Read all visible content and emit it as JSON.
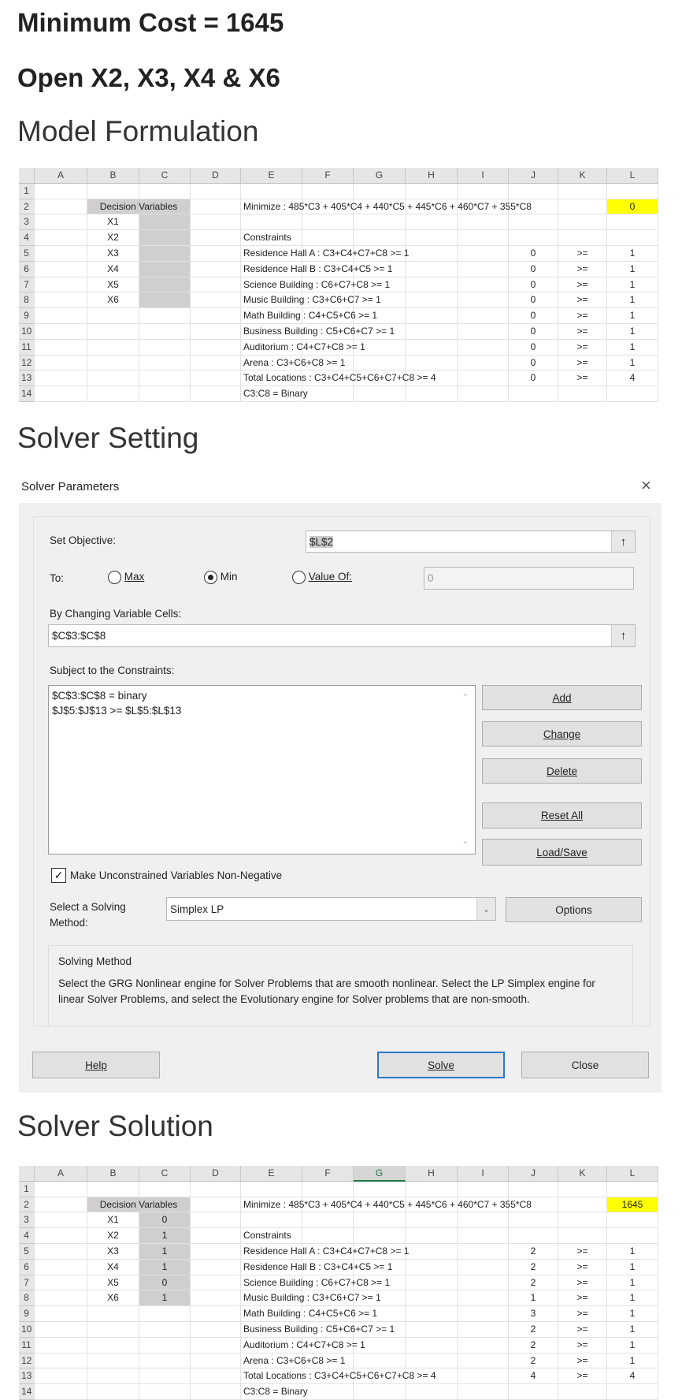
{
  "headings": {
    "min_cost": "Minimum Cost = 1645",
    "open": "Open X2, X3, X4 & X6",
    "model": "Model Formulation",
    "setting": "Solver Setting",
    "solution": "Solver Solution"
  },
  "columns": [
    "A",
    "B",
    "C",
    "D",
    "E",
    "F",
    "G",
    "H",
    "I",
    "J",
    "K",
    "L"
  ],
  "row_numbers": [
    "1",
    "2",
    "3",
    "4",
    "5",
    "6",
    "7",
    "8",
    "9",
    "10",
    "11",
    "12",
    "13",
    "14"
  ],
  "model_sheet": {
    "decision_header": "Decision Variables",
    "variables": [
      "X1",
      "X2",
      "X3",
      "X4",
      "X5",
      "X6"
    ],
    "values": [
      "",
      "",
      "",
      "",
      "",
      ""
    ],
    "objective_label": "Minimize : 485*C3 + 405*C4 + 440*C5 + 445*C6 + 460*C7 + 355*C8",
    "objective_value": "0",
    "constraints_header": "Constraints",
    "constraints": [
      {
        "label": "Residence Hall A : C3+C4+C7+C8 >= 1",
        "lhs": "0",
        "op": ">=",
        "rhs": "1"
      },
      {
        "label": "Residence Hall B : C3+C4+C5 >= 1",
        "lhs": "0",
        "op": ">=",
        "rhs": "1"
      },
      {
        "label": "Science Building : C6+C7+C8 >= 1",
        "lhs": "0",
        "op": ">=",
        "rhs": "1"
      },
      {
        "label": "Music Building : C3+C6+C7 >= 1",
        "lhs": "0",
        "op": ">=",
        "rhs": "1"
      },
      {
        "label": "Math Building : C4+C5+C6 >= 1",
        "lhs": "0",
        "op": ">=",
        "rhs": "1"
      },
      {
        "label": "Business Building : C5+C6+C7 >= 1",
        "lhs": "0",
        "op": ">=",
        "rhs": "1"
      },
      {
        "label": "Auditorium : C4+C7+C8 >= 1",
        "lhs": "0",
        "op": ">=",
        "rhs": "1"
      },
      {
        "label": "Arena : C3+C6+C8 >= 1",
        "lhs": "0",
        "op": ">=",
        "rhs": "1"
      },
      {
        "label": "Total Locations : C3+C4+C5+C6+C7+C8 >= 4",
        "lhs": "0",
        "op": ">=",
        "rhs": "4"
      }
    ],
    "binary_note": "C3:C8 = Binary"
  },
  "solution_sheet": {
    "decision_header": "Decision Variables",
    "variables": [
      "X1",
      "X2",
      "X3",
      "X4",
      "X5",
      "X6"
    ],
    "values": [
      "0",
      "1",
      "1",
      "1",
      "0",
      "1"
    ],
    "objective_label": "Minimize : 485*C3 + 405*C4 + 440*C5 + 445*C6 + 460*C7 + 355*C8",
    "objective_value": "1645",
    "constraints_header": "Constraints",
    "constraints": [
      {
        "label": "Residence Hall A : C3+C4+C7+C8 >= 1",
        "lhs": "2",
        "op": ">=",
        "rhs": "1"
      },
      {
        "label": "Residence Hall B : C3+C4+C5 >= 1",
        "lhs": "2",
        "op": ">=",
        "rhs": "1"
      },
      {
        "label": "Science Building : C6+C7+C8 >= 1",
        "lhs": "2",
        "op": ">=",
        "rhs": "1"
      },
      {
        "label": "Music Building : C3+C6+C7 >= 1",
        "lhs": "1",
        "op": ">=",
        "rhs": "1"
      },
      {
        "label": "Math Building : C4+C5+C6 >= 1",
        "lhs": "3",
        "op": ">=",
        "rhs": "1"
      },
      {
        "label": "Business Building : C5+C6+C7 >= 1",
        "lhs": "2",
        "op": ">=",
        "rhs": "1"
      },
      {
        "label": "Auditorium : C4+C7+C8 >= 1",
        "lhs": "2",
        "op": ">=",
        "rhs": "1"
      },
      {
        "label": "Arena : C3+C6+C8 >= 1",
        "lhs": "2",
        "op": ">=",
        "rhs": "1"
      },
      {
        "label": "Total Locations : C3+C4+C5+C6+C7+C8 >= 4",
        "lhs": "4",
        "op": ">=",
        "rhs": "4"
      }
    ],
    "binary_note": "C3:C8 = Binary"
  },
  "dialog": {
    "title": "Solver Parameters",
    "close": "×",
    "set_objective_label": "Set Objective:",
    "set_objective_value": "$L$2",
    "to_label": "To:",
    "max_label": "Max",
    "min_label": "Min",
    "value_of_label": "Value Of:",
    "value_of_value": "0",
    "selected_goal": "Min",
    "changing_label": "By Changing Variable Cells:",
    "changing_value": "$C$3:$C$8",
    "ref_icon": "↑",
    "subject_label": "Subject to the Constraints:",
    "constraints": [
      "$C$3:$C$8 = binary",
      "$J$5:$J$13 >= $L$5:$L$13"
    ],
    "buttons": {
      "add": "Add",
      "change": "Change",
      "delete": "Delete",
      "reset": "Reset All",
      "load_save": "Load/Save",
      "options": "Options",
      "help": "Help",
      "solve": "Solve",
      "close": "Close"
    },
    "nonneg_label": "Make Unconstrained Variables Non-Negative",
    "nonneg_checked": true,
    "method_label_1": "Select a Solving",
    "method_label_2": "Method:",
    "method_value": "Simplex LP",
    "solving_method_title": "Solving Method",
    "solving_method_text": "Select the GRG Nonlinear engine for Solver Problems that are smooth nonlinear. Select the LP Simplex engine for linear Solver Problems, and select the Evolutionary engine for Solver problems that are non-smooth."
  }
}
